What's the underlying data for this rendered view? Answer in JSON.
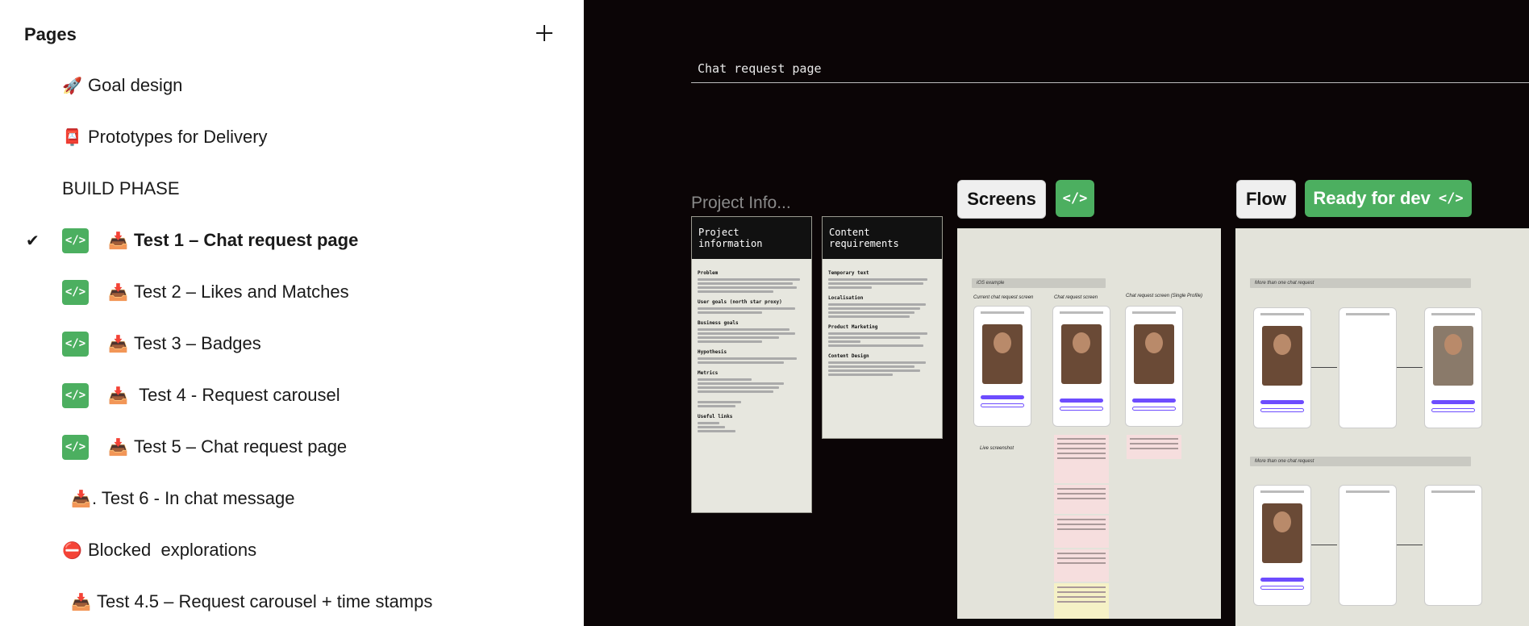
{
  "sidebar": {
    "title": "Pages",
    "add_label": "+",
    "pages": [
      {
        "emoji": "🚀",
        "label": "Goal design"
      },
      {
        "emoji": "📮",
        "label": "Prototypes for Delivery"
      },
      {
        "label": "BUILD PHASE"
      },
      {
        "emoji": "📥",
        "label": "Test 1 – Chat request page",
        "badge": "</>",
        "current": true,
        "check": "✔"
      },
      {
        "emoji": "📥",
        "label": "Test 2 – Likes and Matches",
        "badge": "</>"
      },
      {
        "emoji": "📥",
        "label": "Test 3 – Badges",
        "badge": "</>"
      },
      {
        "emoji": "📥",
        "label": "Test 4 - Request carousel",
        "badge": "</>"
      },
      {
        "emoji": "📥",
        "label": "Test 5 – Chat request page",
        "badge": "</>"
      },
      {
        "emoji": "📥",
        "label": ". Test 6 - In chat message"
      },
      {
        "emoji": "⛔",
        "label": "Blocked  explorations"
      },
      {
        "emoji": "📥",
        "label": "Test 4.5 – Request carousel + time stamps"
      }
    ]
  },
  "canvas": {
    "frame_title": "Chat request page",
    "project_label": "Project Info...",
    "card_project": {
      "title": "Project information",
      "sections": [
        "Problem",
        "User goals (north star proxy)",
        "Business goals",
        "Hypothesis",
        "Metrics",
        "Useful links"
      ]
    },
    "card_content": {
      "title": "Content requirements",
      "sections": [
        "Temporary text",
        "Localisation",
        "Product Marketing",
        "Content Design"
      ]
    },
    "pills": {
      "screens": "Screens",
      "code": "</>",
      "flow": "Flow",
      "ready": "Ready for dev",
      "ready_code": "</>"
    },
    "screens_board": {
      "section": "iOS example",
      "labels": [
        "Current chat request screen",
        "Chat request screen",
        "Chat request screen (Single Profile)"
      ],
      "live_label": "Live screenshot"
    },
    "flow_board": {
      "sections": [
        "More than one chat request",
        "More than one chat request"
      ]
    }
  }
}
